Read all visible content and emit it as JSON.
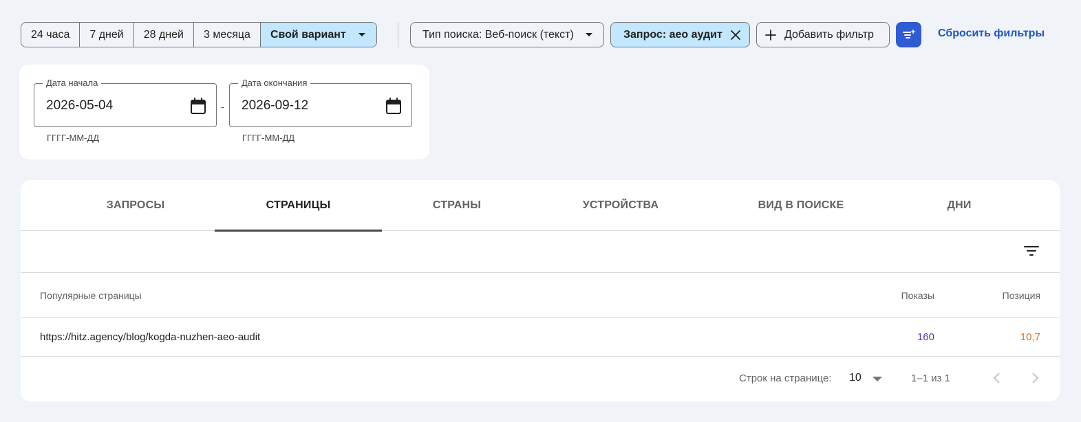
{
  "date_range": {
    "options": [
      "24 часа",
      "7 дней",
      "28 дней",
      "3 месяца"
    ],
    "selected_label": "Свой вариант"
  },
  "filters": {
    "search_type": "Тип поиска: Веб-поиск (текст)",
    "query_chip": "Запрос: aeo аудит",
    "add_filter": "Добавить фильтр",
    "reset": "Сбросить фильтры"
  },
  "custom_range": {
    "start_label": "Дата начала",
    "start_value": "2026-05-04",
    "end_label": "Дата окончания",
    "end_value": "2026-09-12",
    "separator": "-",
    "format_hint": "ГГГГ-ММ-ДД"
  },
  "tabs": [
    {
      "label": "ЗАПРОСЫ",
      "active": false
    },
    {
      "label": "СТРАНИЦЫ",
      "active": true
    },
    {
      "label": "СТРАНЫ",
      "active": false
    },
    {
      "label": "УСТРОЙСТВА",
      "active": false
    },
    {
      "label": "ВИД В ПОИСКЕ",
      "active": false
    },
    {
      "label": "ДНИ",
      "active": false
    }
  ],
  "table": {
    "columns": {
      "pages": "Популярные страницы",
      "impressions": "Показы",
      "position": "Позиция"
    },
    "rows": [
      {
        "url": "https://hitz.agency/blog/kogda-nuzhen-aeo-audit",
        "impressions": "160",
        "position": "10,7"
      }
    ]
  },
  "pagination": {
    "rows_per_page_label": "Строк на странице:",
    "rows_per_page": "10",
    "range": "1–1 из 1"
  },
  "colors": {
    "accent": "#2f5bd3",
    "chip_selected": "#c2e7ff",
    "impressions": "#5e35b1",
    "position": "#e8710a",
    "link": "#1a56c9"
  }
}
